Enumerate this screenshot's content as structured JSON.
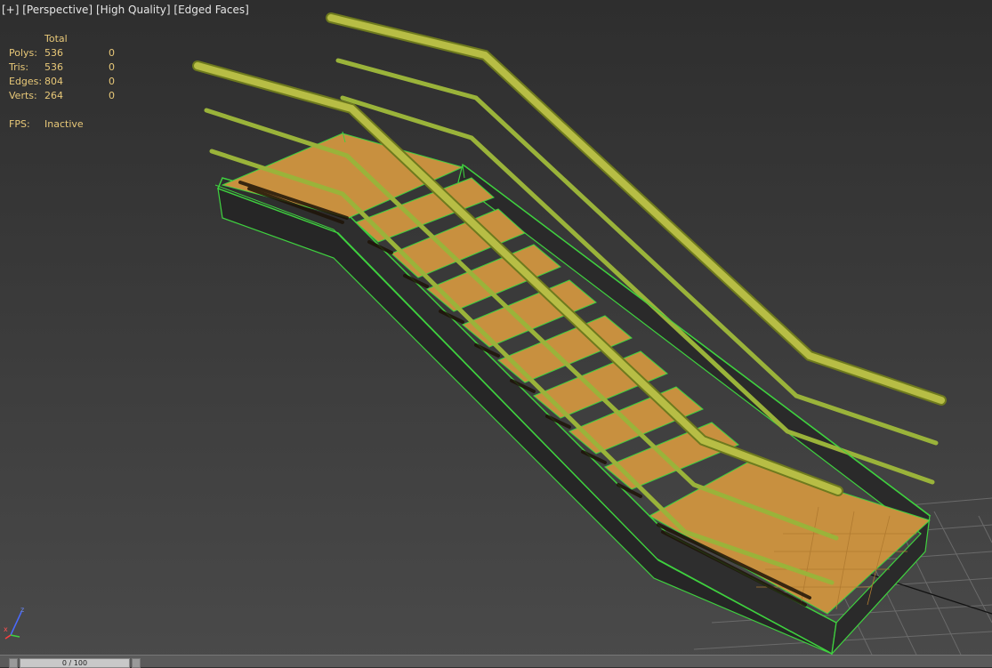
{
  "viewport": {
    "labels": [
      "[+]",
      "[Perspective]",
      "[High Quality]",
      "[Edged Faces]"
    ]
  },
  "stats": {
    "header": "Total",
    "rows": [
      {
        "label": "Polys:",
        "total": "536",
        "selected": "0"
      },
      {
        "label": "Tris:",
        "total": "536",
        "selected": "0"
      },
      {
        "label": "Edges:",
        "total": "804",
        "selected": "0"
      },
      {
        "label": "Verts:",
        "total": "264",
        "selected": "0"
      }
    ],
    "fps_label": "FPS:",
    "fps_value": "Inactive"
  },
  "axis": {
    "z": "z",
    "x": "x"
  },
  "timeline": {
    "text": "0 / 100"
  },
  "colors": {
    "step": "#c8903f",
    "rail": "#9aa53a",
    "wire": "#3fd13f",
    "stringer": "#2f2f2f"
  }
}
